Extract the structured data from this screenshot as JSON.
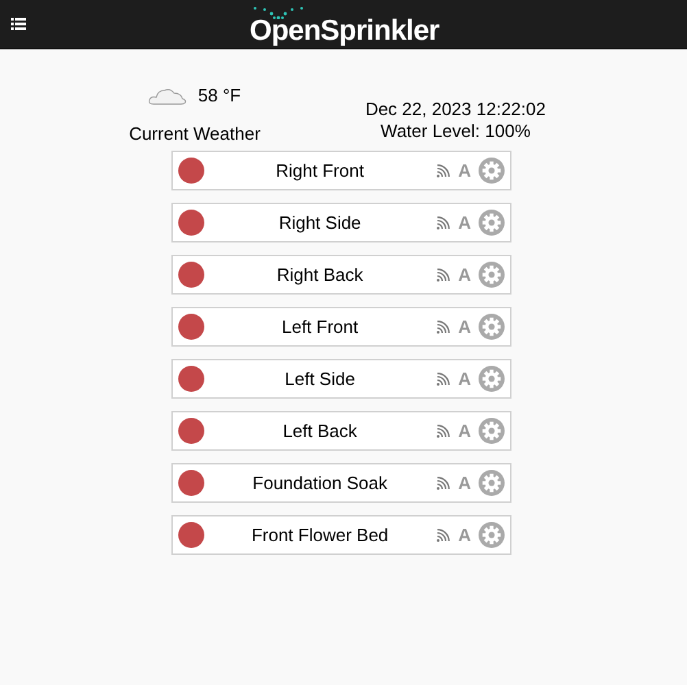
{
  "header": {
    "logo": "OpenSprinkler"
  },
  "weather": {
    "temperature": "58 °F",
    "label": "Current Weather"
  },
  "status": {
    "datetime": "Dec 22, 2023 12:22:02",
    "water_level": "Water Level: 100%"
  },
  "stations": [
    {
      "name": "Right Front",
      "running": false,
      "mode": "A"
    },
    {
      "name": "Right Side",
      "running": false,
      "mode": "A"
    },
    {
      "name": "Right Back",
      "running": false,
      "mode": "A"
    },
    {
      "name": "Left Front",
      "running": false,
      "mode": "A"
    },
    {
      "name": "Left Side",
      "running": false,
      "mode": "A"
    },
    {
      "name": "Left Back",
      "running": false,
      "mode": "A"
    },
    {
      "name": "Foundation Soak",
      "running": false,
      "mode": "A"
    },
    {
      "name": "Front Flower Bed",
      "running": false,
      "mode": "A"
    }
  ]
}
